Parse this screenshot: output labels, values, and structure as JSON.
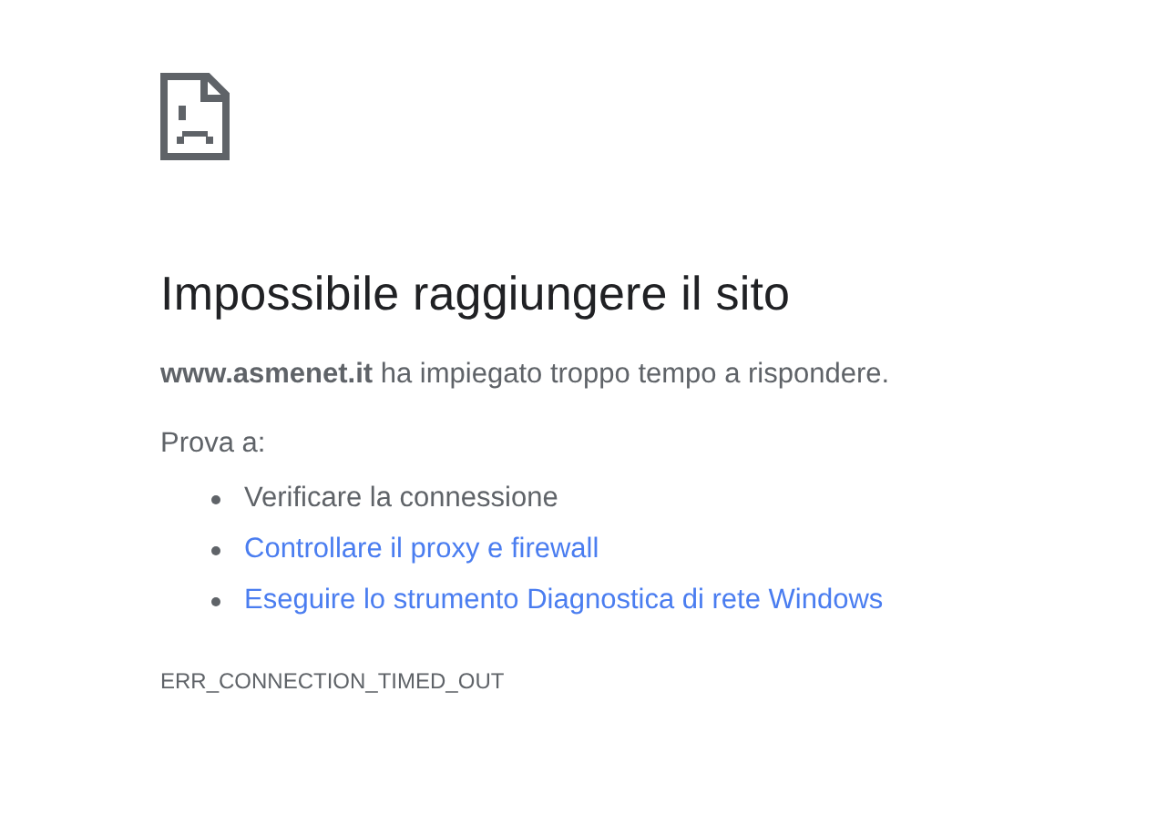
{
  "heading": "Impossibile raggiungere il sito",
  "message": "**www.asmenet.it** ha impiegato troppo tempo a rispondere.",
  "suggestions_label": "Prova a:",
  "suggestions": [
    {
      "kind": "text",
      "text": "Verificare la connessione"
    },
    {
      "kind": "link",
      "text": "Controllare il proxy e firewall"
    },
    {
      "kind": "link",
      "text": "Eseguire lo strumento Diagnostica di rete Windows"
    }
  ],
  "error_code": "ERR_CONNECTION_TIMED_OUT"
}
